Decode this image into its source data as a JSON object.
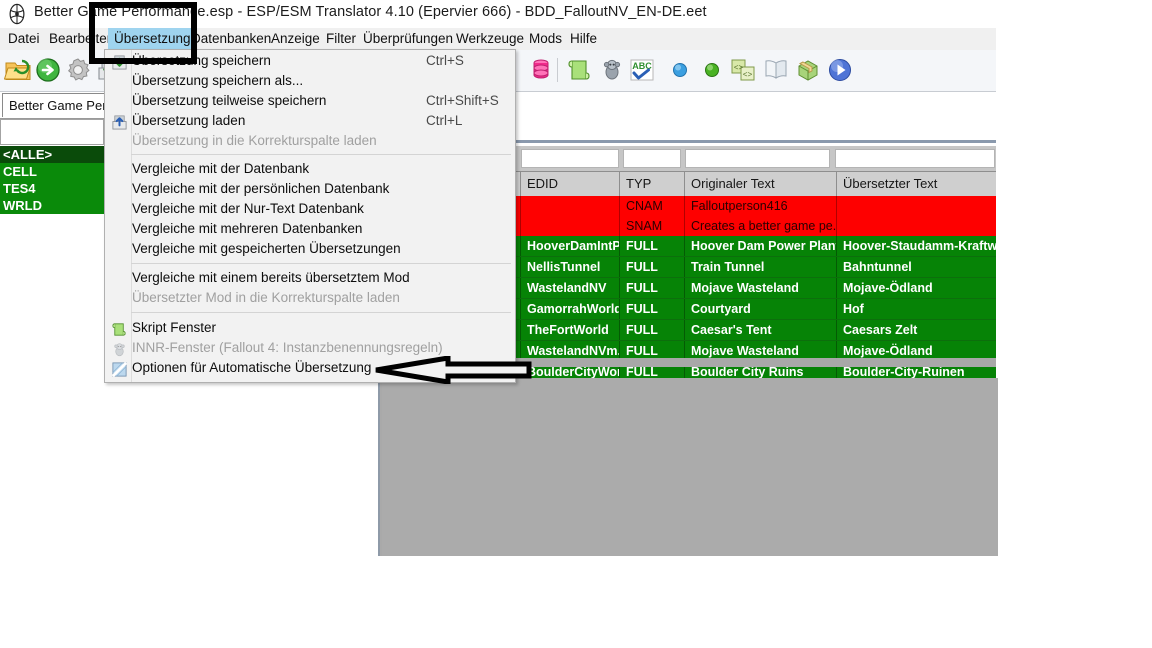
{
  "window": {
    "title": "Better Game Performance.esp - ESP/ESM Translator 4.10 (Epervier 666) - BDD_FalloutNV_EN-DE.eet",
    "app_icon": "translator-logo-icon"
  },
  "menubar": {
    "items": [
      {
        "label": "Datei",
        "selected": false
      },
      {
        "label": "Bearbeiten",
        "selected": false
      },
      {
        "label": "Übersetzung",
        "selected": true
      },
      {
        "label": "Datenbanken",
        "selected": false
      },
      {
        "label": "Anzeige",
        "selected": false
      },
      {
        "label": "Filter",
        "selected": false
      },
      {
        "label": "Überprüfungen",
        "selected": false
      },
      {
        "label": "Werkzeuge",
        "selected": false
      },
      {
        "label": "Mods",
        "selected": false
      },
      {
        "label": "Hilfe",
        "selected": false
      }
    ]
  },
  "toolbar": {
    "left_icons": [
      {
        "name": "open-folder-icon",
        "color": "#f0a830"
      },
      {
        "name": "green-arrow-icon",
        "color": "#1f9b1f"
      },
      {
        "name": "gear-icon",
        "color": "#b9b9b9"
      },
      {
        "name": "save-translation-icon",
        "color": "#7ab648"
      }
    ],
    "right_icons": [
      {
        "name": "database-disabled-icon",
        "color": "#d8d8d8"
      },
      {
        "name": "database-icon",
        "color": "#f02a8a"
      },
      {
        "name": "script-scroll-icon",
        "color": "#8ed45e"
      },
      {
        "name": "monkey-icon",
        "color": "#9aa3ad"
      },
      {
        "name": "abc-spellcheck-icon",
        "color": "#2f8f2f"
      },
      {
        "name": "blue-dot-icon",
        "color": "#3b9fe0"
      },
      {
        "name": "green-dot-icon",
        "color": "#49b223"
      },
      {
        "name": "code-swap-icon",
        "color": "#cfe08a"
      },
      {
        "name": "book-icon",
        "color": "#d6dde6"
      },
      {
        "name": "package-box-icon",
        "color": "#9fcf6f"
      },
      {
        "name": "play-button-icon",
        "color": "#4a6fd0"
      }
    ]
  },
  "left_panel": {
    "tab_label": "Better Game Perfo",
    "search_value": "",
    "search_placeholder": "",
    "list_items": [
      {
        "label": "<ALLE>",
        "selected": true
      },
      {
        "label": "CELL",
        "selected": false
      },
      {
        "label": "TES4",
        "selected": false
      },
      {
        "label": "WRLD",
        "selected": false
      }
    ]
  },
  "menu_dropdown": {
    "groups": [
      {
        "items": [
          {
            "label": "Übersetzung speichern",
            "shortcut": "Ctrl+S",
            "disabled": false,
            "icon": "save-down-icon"
          },
          {
            "label": "Übersetzung speichern als...",
            "shortcut": "",
            "disabled": false,
            "icon": ""
          },
          {
            "label": "Übersetzung teilweise speichern",
            "shortcut": "Ctrl+Shift+S",
            "disabled": false,
            "icon": ""
          },
          {
            "label": "Übersetzung laden",
            "shortcut": "Ctrl+L",
            "disabled": false,
            "icon": "load-up-icon"
          },
          {
            "label": "Übersetzung in die Korrekturspalte laden",
            "shortcut": "",
            "disabled": true,
            "icon": ""
          }
        ]
      },
      {
        "items": [
          {
            "label": "Vergleiche mit der Datenbank",
            "shortcut": "",
            "disabled": false,
            "icon": ""
          },
          {
            "label": "Vergleiche mit der persönlichen Datenbank",
            "shortcut": "",
            "disabled": false,
            "icon": ""
          },
          {
            "label": "Vergleiche mit der Nur-Text Datenbank",
            "shortcut": "",
            "disabled": false,
            "icon": ""
          },
          {
            "label": "Vergleiche mit mehreren Datenbanken",
            "shortcut": "",
            "disabled": false,
            "icon": ""
          },
          {
            "label": "Vergleiche mit gespeicherten Übersetzungen",
            "shortcut": "",
            "disabled": false,
            "icon": ""
          }
        ]
      },
      {
        "items": [
          {
            "label": "Vergleiche mit einem bereits übersetztem Mod",
            "shortcut": "",
            "disabled": false,
            "icon": ""
          },
          {
            "label": "Übersetzter Mod in die Korrekturspalte laden",
            "shortcut": "",
            "disabled": true,
            "icon": ""
          }
        ]
      },
      {
        "items": [
          {
            "label": "Skript Fenster",
            "shortcut": "",
            "disabled": false,
            "icon": "script-scroll-icon"
          },
          {
            "label": "INNR-Fenster (Fallout 4: Instanzbenennungsregeln)",
            "shortcut": "",
            "disabled": true,
            "icon": "monkey-icon"
          },
          {
            "label": "Optionen für Automatische Übersetzung",
            "shortcut": "",
            "disabled": false,
            "icon": "auto-translate-icon"
          }
        ]
      }
    ]
  },
  "table": {
    "filter_values": [
      "",
      "",
      "",
      ""
    ],
    "columns": [
      "EDID",
      "TYP",
      "Originaler Text",
      "Übersetzter Text"
    ],
    "rows": [
      {
        "status": "red",
        "edid": "",
        "typ": "CNAM",
        "original": "Falloutperson416",
        "translated": ""
      },
      {
        "status": "red",
        "edid": "",
        "typ": "SNAM",
        "original": "Creates a better game pe...",
        "translated": ""
      },
      {
        "status": "green",
        "edid": "HooverDamIntP...",
        "typ": "FULL",
        "original": "Hoover Dam Power Plant...",
        "translated": "Hoover-Staudamm-Kraftwerk"
      },
      {
        "status": "green",
        "edid": "NellisTunnel",
        "typ": "FULL",
        "original": "Train Tunnel",
        "translated": "Bahntunnel"
      },
      {
        "status": "green",
        "edid": "WastelandNV",
        "typ": "FULL",
        "original": "Mojave Wasteland",
        "translated": "Mojave-Ödland"
      },
      {
        "status": "green",
        "edid": "GamorrahWorld",
        "typ": "FULL",
        "original": "Courtyard",
        "translated": "Hof"
      },
      {
        "status": "green",
        "edid": "TheFortWorld",
        "typ": "FULL",
        "original": "Caesar's Tent",
        "translated": "Caesars Zelt"
      },
      {
        "status": "green",
        "edid": "WastelandNVm...",
        "typ": "FULL",
        "original": "Mojave Wasteland",
        "translated": "Mojave-Ödland"
      },
      {
        "status": "green",
        "edid": "BoulderCityWor...",
        "typ": "FULL",
        "original": "Boulder City Ruins",
        "translated": "Boulder-City-Ruinen"
      }
    ]
  },
  "annotations": {
    "highlight_box": {
      "name": "uebersetzung-menu-highlight",
      "color": "#000000"
    },
    "arrow": {
      "name": "pointer-arrow-to-auto-translate-options",
      "color": "#000000",
      "direction": "left"
    }
  },
  "colors": {
    "menu_selected": "#9fd4ef",
    "row_red": "#fe0000",
    "row_green": "#068306",
    "list_green": "#0a8a0a",
    "list_green_selected": "#0a4b0a",
    "header_grey": "#cfcfcf",
    "panel_grey": "#a9a9a9"
  }
}
